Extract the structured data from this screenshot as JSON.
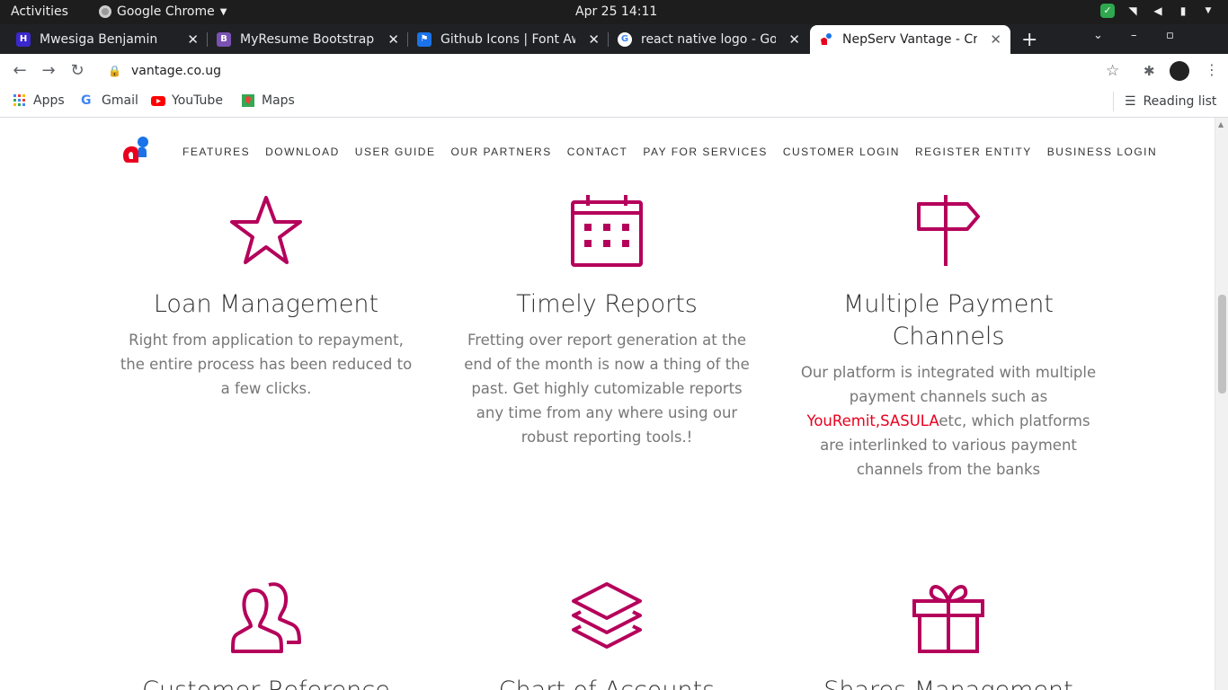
{
  "os_bar": {
    "activities": "Activities",
    "app_name": "Google Chrome",
    "clock": "Apr 25  14:11"
  },
  "tabs": [
    {
      "title": "Mwesiga Benjamin",
      "favicon_color": "#3b28cc",
      "favicon_letter": "H"
    },
    {
      "title": "MyResume Bootstrap T",
      "favicon_color": "#7952b3",
      "favicon_letter": "B"
    },
    {
      "title": "Github Icons | Font Awe",
      "favicon_color": "#1a73e8",
      "favicon_letter": "⚑"
    },
    {
      "title": "react native logo - Goog",
      "favicon_color": "#ffffff",
      "favicon_letter": "G"
    },
    {
      "title": "NepServ Vantage - Crea",
      "favicon_color": "#e8001e",
      "favicon_letter": ""
    }
  ],
  "address_bar": {
    "url": "vantage.co.ug"
  },
  "bookmarks": {
    "apps": "Apps",
    "gmail": "Gmail",
    "youtube": "YouTube",
    "maps": "Maps",
    "reading_list": "Reading list"
  },
  "site_nav": {
    "links": [
      "FEATURES",
      "DOWNLOAD",
      "USER GUIDE",
      "OUR PARTNERS",
      "CONTACT",
      "PAY FOR SERVICES",
      "CUSTOMER LOGIN",
      "REGISTER ENTITY",
      "BUSINESS LOGIN"
    ]
  },
  "features": {
    "loan": {
      "title": "Loan Management",
      "text": "Right from application to repayment, the entire process has been reduced to a few clicks.",
      "icon": "star-icon"
    },
    "reports": {
      "title": "Timely Reports",
      "text": "Fretting over report generation at the end of the month is now a thing of the past. Get highly cutomizable reports any time from any where using our robust reporting tools.!",
      "icon": "calendar-icon"
    },
    "payments": {
      "title": "Multiple Payment Channels",
      "text_before": "Our platform is integrated with multiple payment channels such as ",
      "link1": "YouRemit",
      "comma": ",",
      "link2": "SASULA",
      "text_after": "etc, which platforms are interlinked to various payment channels from the banks",
      "icon": "signpost-icon"
    },
    "customer": {
      "title": "Customer Reference",
      "icon": "users-icon"
    },
    "accounts": {
      "title": "Chart of Accounts",
      "icon": "layers-icon"
    },
    "shares": {
      "title": "Shares Management",
      "icon": "gift-icon"
    }
  },
  "colors": {
    "accent": "#b5005b",
    "link_red": "#e8001e"
  }
}
